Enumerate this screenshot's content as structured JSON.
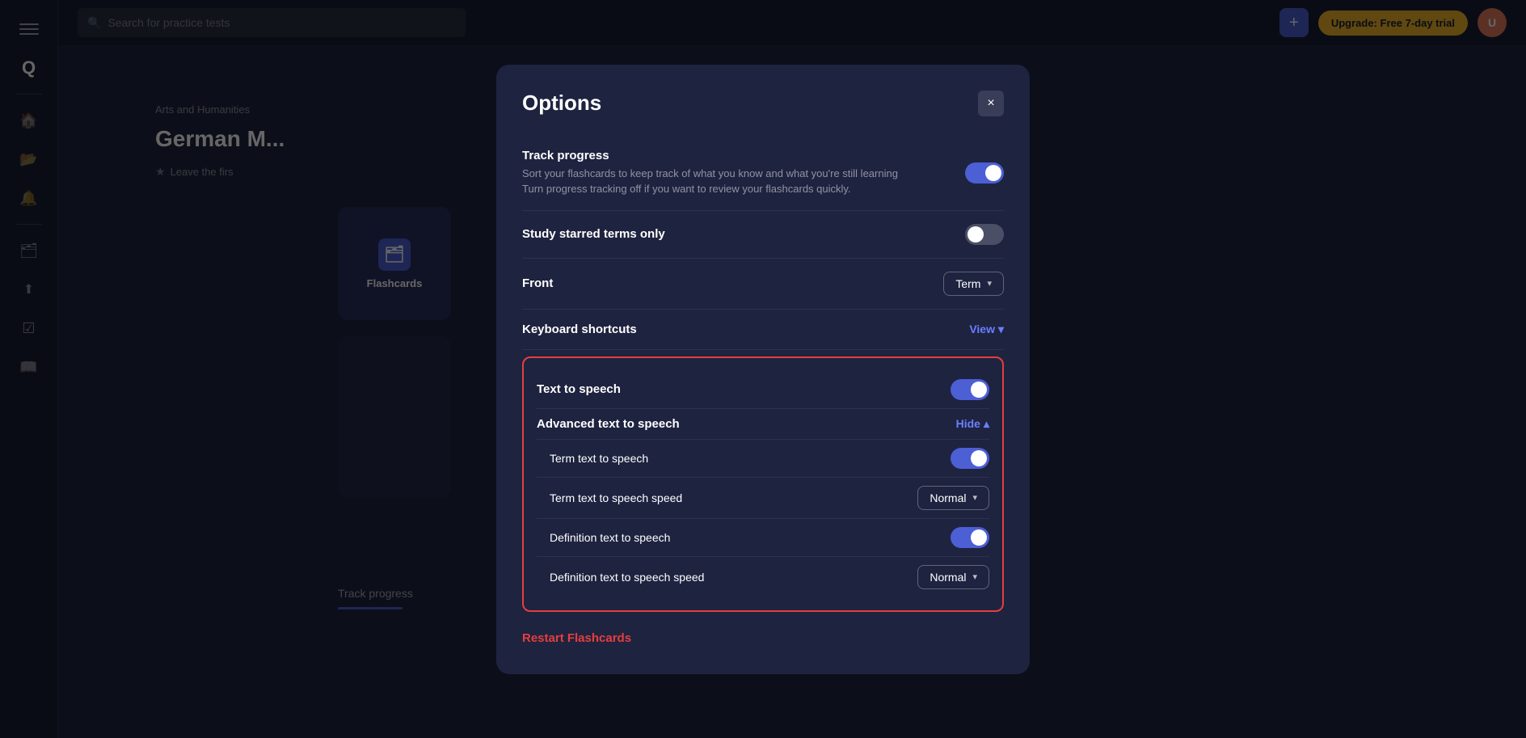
{
  "app": {
    "logo": "Q",
    "search_placeholder": "Search for practice tests"
  },
  "topbar": {
    "plus_label": "+",
    "upgrade_label": "Upgrade: Free 7-day trial",
    "avatar_initials": "U"
  },
  "sidebar": {
    "items": [
      {
        "name": "home",
        "icon": "⌂"
      },
      {
        "name": "library",
        "icon": "📁"
      },
      {
        "name": "notifications",
        "icon": "🔔"
      },
      {
        "name": "flashcards",
        "icon": "🗂"
      },
      {
        "name": "upload",
        "icon": "↑"
      },
      {
        "name": "checklist",
        "icon": "✓"
      },
      {
        "name": "book",
        "icon": "📖"
      }
    ]
  },
  "page": {
    "breadcrumb": "Arts and Humanities",
    "title": "German M...",
    "leave_first": "Leave the firs",
    "tab_flashcards_label": "Flashcards",
    "progress_label": "Track progress"
  },
  "modal": {
    "title": "Options",
    "close_label": "×",
    "sections": {
      "track_progress": {
        "label": "Track progress",
        "description": "Sort your flashcards to keep track of what you know and what you're still learning Turn progress tracking off if you want to review your flashcards quickly.",
        "toggle_state": "on"
      },
      "study_starred": {
        "label": "Study starred terms only",
        "toggle_state": "off"
      },
      "front": {
        "label": "Front",
        "dropdown_label": "Term",
        "dropdown_chevron": "▾"
      },
      "keyboard_shortcuts": {
        "label": "Keyboard shortcuts",
        "view_label": "View",
        "view_chevron": "▾"
      },
      "text_to_speech": {
        "label": "Text to speech",
        "toggle_state": "on",
        "advanced_label": "Advanced text to speech",
        "hide_label": "Hide",
        "hide_chevron": "▴",
        "term_tts_label": "Term text to speech",
        "term_tts_state": "on",
        "term_speed_label": "Term text to speech speed",
        "term_speed_value": "Normal",
        "term_speed_chevron": "▾",
        "def_tts_label": "Definition text to speech",
        "def_tts_state": "on",
        "def_speed_label": "Definition text to speech speed",
        "def_speed_value": "Normal",
        "def_speed_chevron": "▾"
      },
      "restart": {
        "label": "Restart Flashcards"
      }
    }
  }
}
